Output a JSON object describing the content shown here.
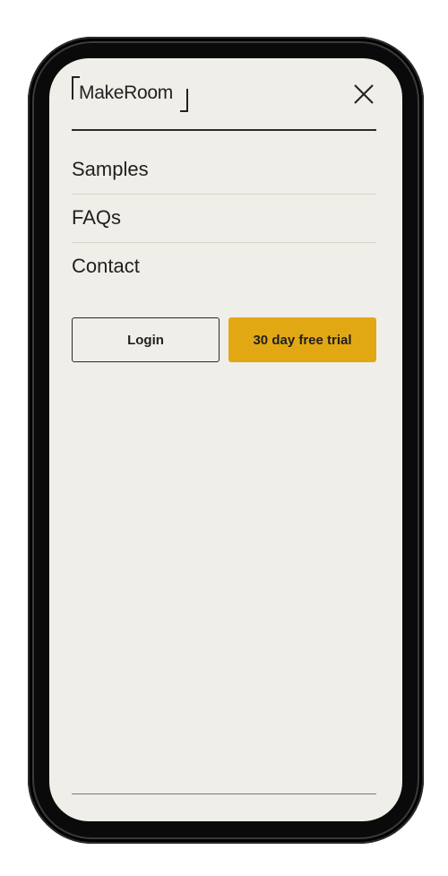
{
  "brand": {
    "name": "MakeRoom"
  },
  "nav": {
    "items": [
      {
        "label": "Samples"
      },
      {
        "label": "FAQs"
      },
      {
        "label": "Contact"
      }
    ]
  },
  "actions": {
    "login_label": "Login",
    "trial_label": "30 day free trial"
  },
  "icons": {
    "close": "close-icon",
    "logo": "makeroom-logo"
  },
  "colors": {
    "background": "#f0eee9",
    "accent": "#e2a814",
    "text": "#1f1f1f",
    "device_frame": "#0a0a0a"
  }
}
